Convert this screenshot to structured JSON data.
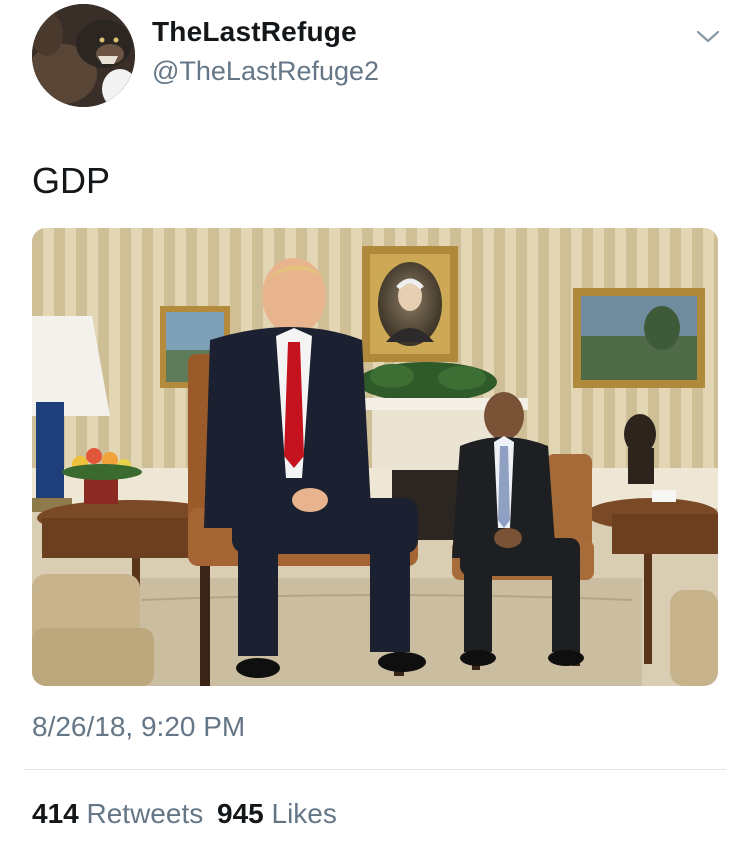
{
  "author": {
    "display_name": "TheLastRefuge",
    "handle": "@TheLastRefuge2",
    "avatar_icon": "wolf-avatar-icon"
  },
  "tweet": {
    "text": "GDP",
    "media_description_icon": "photo",
    "timestamp": "8/26/18, 9:20 PM"
  },
  "stats": {
    "retweets_count": "414",
    "retweets_label": "Retweets",
    "likes_count": "945",
    "likes_label": "Likes"
  },
  "colors": {
    "primary_text": "#14171a",
    "secondary_text": "#657786",
    "divider": "#e1e8ed"
  }
}
